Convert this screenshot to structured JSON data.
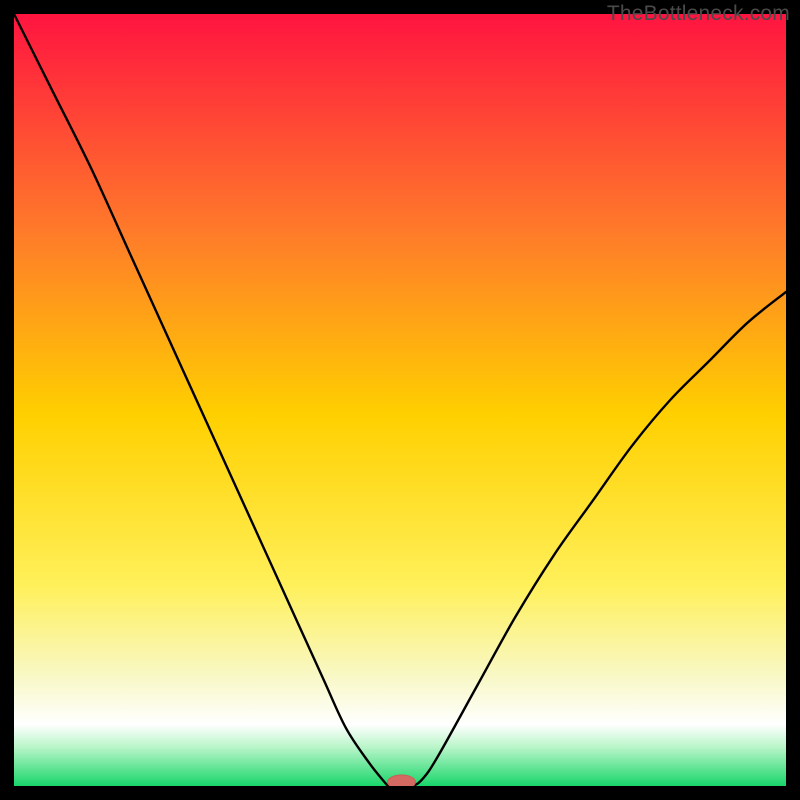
{
  "watermark": "TheBottleneck.com",
  "colors": {
    "bg": "#000000",
    "grad_top": "#ff1440",
    "grad_mid_upper": "#ff7a2a",
    "grad_mid": "#ffd000",
    "grad_mid_lower": "#fff05a",
    "grad_pale": "#f8f8c8",
    "grad_white": "#ffffff",
    "grad_mint": "#b8f5c8",
    "grad_green": "#18d66a",
    "curve": "#000000",
    "marker_fill": "#d46a62",
    "marker_stroke": "#cc5f56"
  },
  "chart_data": {
    "type": "line",
    "x": [
      0.0,
      0.05,
      0.1,
      0.15,
      0.2,
      0.25,
      0.3,
      0.35,
      0.4,
      0.43,
      0.46,
      0.48,
      0.485,
      0.49,
      0.515,
      0.53,
      0.55,
      0.6,
      0.65,
      0.7,
      0.75,
      0.8,
      0.85,
      0.9,
      0.95,
      1.0
    ],
    "y": [
      1.0,
      0.9,
      0.8,
      0.69,
      0.58,
      0.47,
      0.36,
      0.25,
      0.14,
      0.075,
      0.03,
      0.005,
      0.0,
      0.0,
      0.0,
      0.01,
      0.04,
      0.13,
      0.22,
      0.3,
      0.37,
      0.44,
      0.5,
      0.55,
      0.6,
      0.64
    ],
    "marker": {
      "x": 0.502,
      "y": 0.0,
      "rx": 0.018,
      "ry": 0.009
    },
    "xlim": [
      0,
      1
    ],
    "ylim": [
      0,
      1
    ],
    "title": "",
    "xlabel": "",
    "ylabel": ""
  }
}
